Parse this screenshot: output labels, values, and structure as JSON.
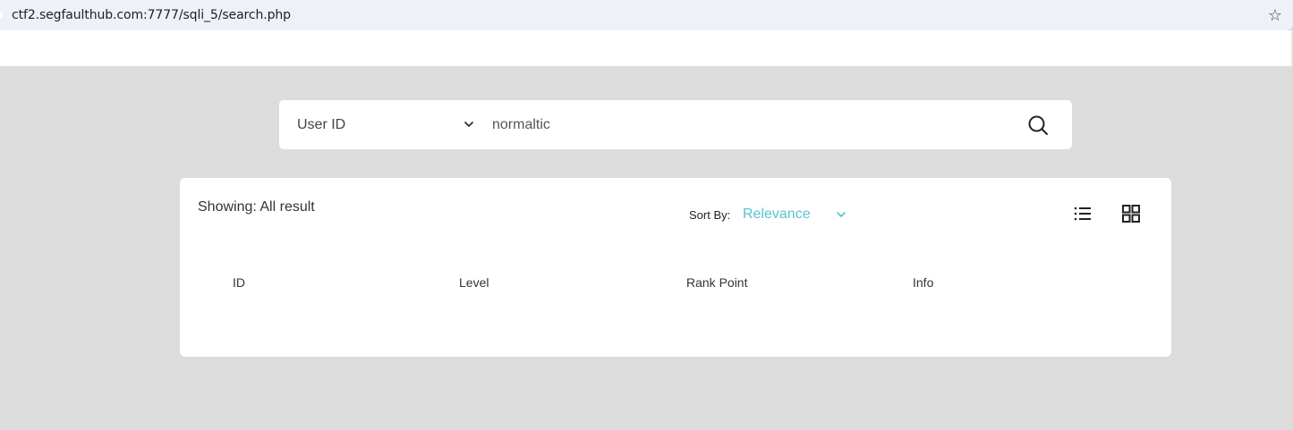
{
  "browser": {
    "url": "ctf2.segfaulthub.com:7777/sqli_5/search.php",
    "bookmark_icon": "star-icon"
  },
  "search": {
    "field_selected": "User ID",
    "query_value": "normaltic",
    "query_placeholder": "",
    "search_icon": "search-icon"
  },
  "results": {
    "showing_text": "Showing: All result",
    "sort_label": "Sort By:",
    "sort_value": "Relevance",
    "columns": [
      "ID",
      "Level",
      "Rank Point",
      "Info"
    ]
  },
  "colors": {
    "page_bg": "#dcdcdc",
    "accent": "#58c2d0",
    "card_bg": "#ffffff"
  }
}
